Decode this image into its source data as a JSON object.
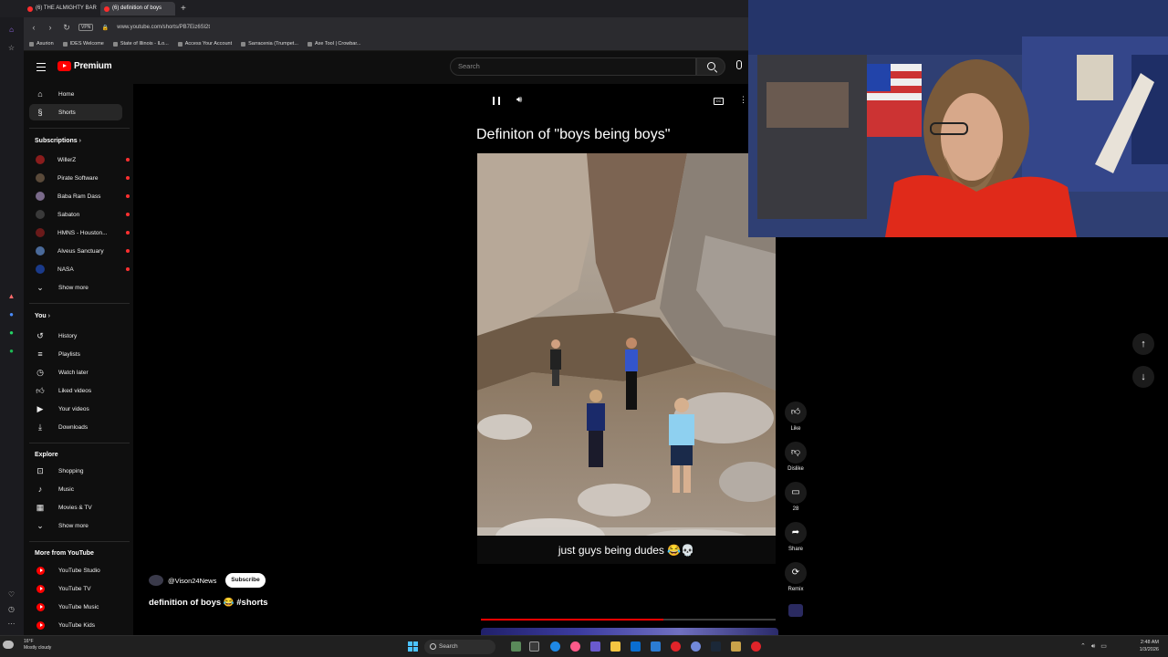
{
  "browser": {
    "tabs": [
      {
        "title": "(6) THE ALMIGHTY BAR !!!",
        "active": false
      },
      {
        "title": "(6) definition of boys",
        "active": true
      }
    ],
    "url": "www.youtube.com/shorts/PB7Eiz6Sl2t",
    "vpn_label": "VPN",
    "bookmarks": [
      "Asurion",
      "IDES Welcome",
      "State of Illinois - ILo...",
      "Access Your Account",
      "Sarracenia (Trumpet...",
      "Axe Tool | Crowbar..."
    ]
  },
  "header": {
    "brand": "Premium",
    "search_placeholder": "Search"
  },
  "sidebar": {
    "main": [
      {
        "label": "Home",
        "icon": "home-icon"
      },
      {
        "label": "Shorts",
        "icon": "shorts-icon",
        "active": true
      }
    ],
    "subscriptions_title": "Subscriptions",
    "subscriptions": [
      {
        "label": "WillerZ",
        "color": "#8a1c1c"
      },
      {
        "label": "Pirate Software",
        "color": "#5a4a3a"
      },
      {
        "label": "Baba Ram Dass",
        "color": "#7a6a8a"
      },
      {
        "label": "Sabaton",
        "color": "#3a3a3a"
      },
      {
        "label": "HMNS - Houston...",
        "color": "#6a1a1a"
      },
      {
        "label": "Alveus Sanctuary",
        "color": "#4a6a9a"
      },
      {
        "label": "NASA",
        "color": "#1a3a8a"
      }
    ],
    "show_more": "Show more",
    "you_title": "You",
    "you": [
      {
        "label": "History",
        "icon": "history-icon"
      },
      {
        "label": "Playlists",
        "icon": "playlists-icon"
      },
      {
        "label": "Watch later",
        "icon": "clock-icon"
      },
      {
        "label": "Liked videos",
        "icon": "thumbs-up-icon"
      },
      {
        "label": "Your videos",
        "icon": "video-icon"
      },
      {
        "label": "Downloads",
        "icon": "download-icon"
      }
    ],
    "explore_title": "Explore",
    "explore": [
      {
        "label": "Shopping",
        "icon": "shopping-bag-icon"
      },
      {
        "label": "Music",
        "icon": "music-note-icon"
      },
      {
        "label": "Movies & TV",
        "icon": "film-icon"
      }
    ],
    "explore_show_more": "Show more",
    "more_title": "More from YouTube",
    "more": [
      {
        "label": "YouTube Studio"
      },
      {
        "label": "YouTube TV"
      },
      {
        "label": "YouTube Music"
      },
      {
        "label": "YouTube Kids"
      }
    ]
  },
  "player": {
    "title": "Definiton of \"boys being boys\"",
    "caption": "just guys being dudes 😂💀",
    "progress": 0.62
  },
  "channel": {
    "handle": "@Vison24News",
    "subscribe_label": "Subscribe",
    "short_title": "definition of boys 😂 #shorts"
  },
  "actions": {
    "like": "Like",
    "dislike": "Dislike",
    "comments": "28",
    "share": "Share",
    "remix": "Remix"
  },
  "taskbar": {
    "temp": "16°F",
    "weather": "Mostly cloudy",
    "search": "Search",
    "time": "2:48 AM",
    "date": "1/3/2026"
  }
}
